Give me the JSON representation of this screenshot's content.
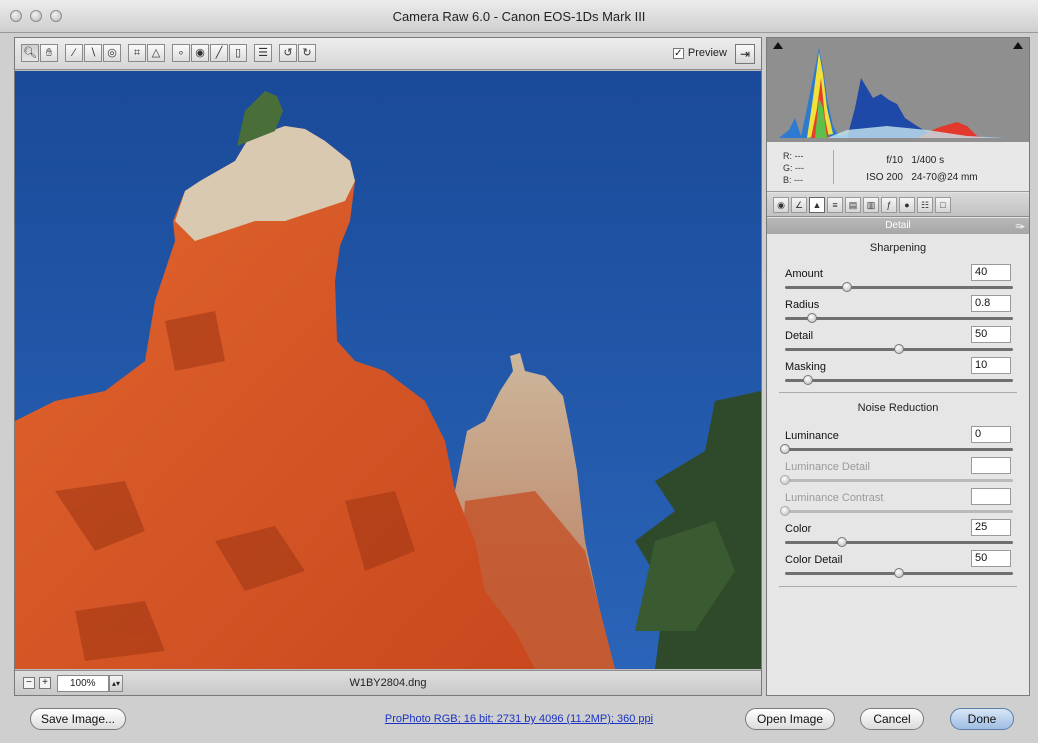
{
  "window": {
    "title": "Camera Raw 6.0  -  Canon EOS-1Ds Mark III"
  },
  "toolbar": {
    "tools": [
      "zoom-icon",
      "hand-icon",
      "white-balance-icon",
      "color-sampler-icon",
      "targeted-adjustment-icon",
      "crop-icon",
      "straighten-icon",
      "spot-removal-icon",
      "red-eye-icon",
      "adjustment-brush-icon",
      "graduated-filter-icon",
      "preferences-icon",
      "rotate-left-icon",
      "rotate-right-icon"
    ],
    "preview_label": "Preview",
    "preview_checked": true
  },
  "status": {
    "zoom": "100%",
    "filename": "W1BY2804.dng"
  },
  "info": {
    "r_label": "R:",
    "r_value": "---",
    "g_label": "G:",
    "g_value": "---",
    "b_label": "B:",
    "b_value": "---",
    "aperture": "f/10",
    "shutter": "1/400 s",
    "iso": "ISO 200",
    "lens": "24-70@24 mm"
  },
  "panel": {
    "title": "Detail",
    "tabs": [
      "basic-icon",
      "tone-curve-icon",
      "detail-icon",
      "hsl-icon",
      "split-toning-icon",
      "lens-corrections-icon",
      "effects-icon",
      "camera-calibration-icon",
      "presets-icon",
      "snapshots-icon"
    ],
    "active_tab": 2
  },
  "sharpening": {
    "title": "Sharpening",
    "sliders": [
      {
        "label": "Amount",
        "value": "40",
        "fraction": 0.27,
        "enabled": true
      },
      {
        "label": "Radius",
        "value": "0.8",
        "fraction": 0.12,
        "enabled": true
      },
      {
        "label": "Detail",
        "value": "50",
        "fraction": 0.5,
        "enabled": true
      },
      {
        "label": "Masking",
        "value": "10",
        "fraction": 0.1,
        "enabled": true
      }
    ]
  },
  "noise_reduction": {
    "title": "Noise Reduction",
    "sliders": [
      {
        "label": "Luminance",
        "value": "0",
        "fraction": 0.0,
        "enabled": true
      },
      {
        "label": "Luminance Detail",
        "value": "",
        "fraction": 0.0,
        "enabled": false
      },
      {
        "label": "Luminance Contrast",
        "value": "",
        "fraction": 0.0,
        "enabled": false
      },
      {
        "label": "Color",
        "value": "25",
        "fraction": 0.25,
        "enabled": true
      },
      {
        "label": "Color Detail",
        "value": "50",
        "fraction": 0.5,
        "enabled": true
      }
    ]
  },
  "footer": {
    "save_label": "Save Image...",
    "workflow_link": "ProPhoto RGB; 16 bit; 2731 by 4096 (11.2MP); 360 ppi",
    "open_label": "Open Image",
    "cancel_label": "Cancel",
    "done_label": "Done"
  },
  "colors": {
    "sky": "#1d4f9e",
    "rock": "#d8562a",
    "link": "#1a33c4",
    "default_button": "#9fbde3"
  }
}
